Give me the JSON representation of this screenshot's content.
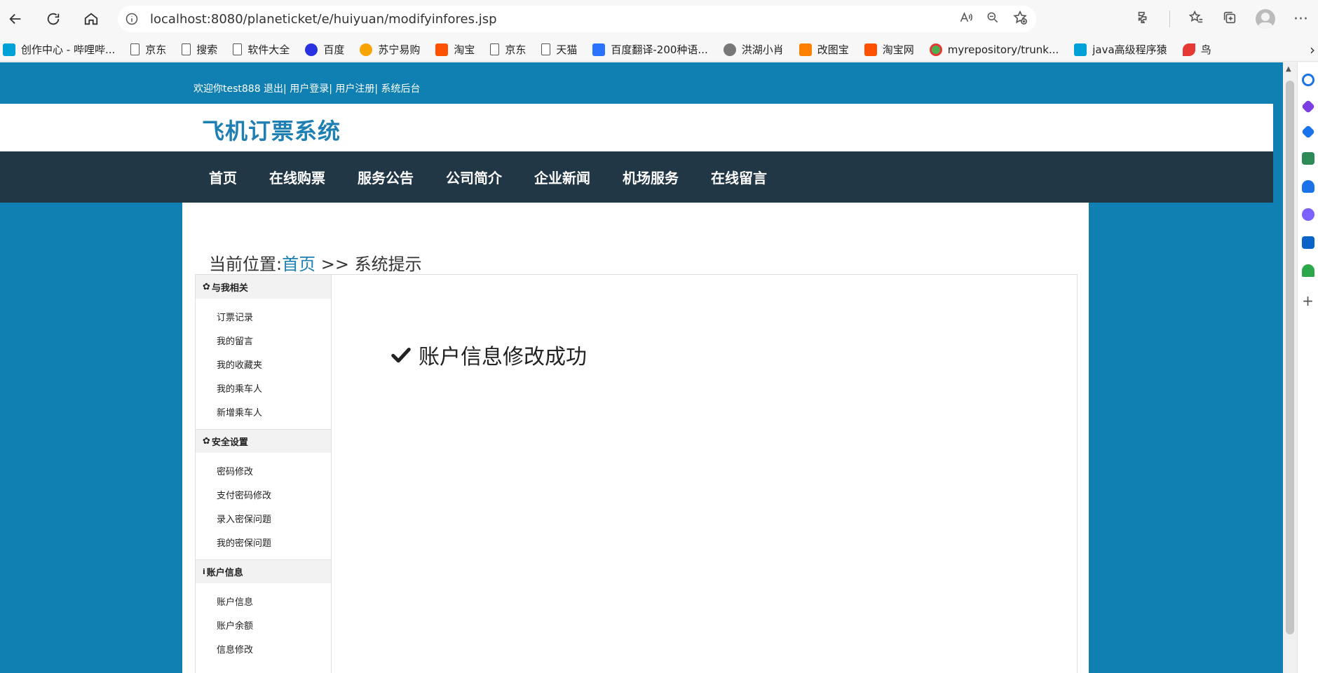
{
  "browser": {
    "url": "localhost:8080/planeticket/e/huiyuan/modifyinfores.jsp"
  },
  "bookmarks": [
    {
      "label": "创作中心 - 哔哩哔...",
      "icon": "bilibili-icon"
    },
    {
      "label": "京东",
      "icon": "page-icon"
    },
    {
      "label": "搜索",
      "icon": "page-icon"
    },
    {
      "label": "软件大全",
      "icon": "page-icon"
    },
    {
      "label": "百度",
      "icon": "baidu-icon"
    },
    {
      "label": "苏宁易购",
      "icon": "suning-icon"
    },
    {
      "label": "淘宝",
      "icon": "taobao-icon"
    },
    {
      "label": "京东",
      "icon": "page-icon"
    },
    {
      "label": "天猫",
      "icon": "page-icon"
    },
    {
      "label": "百度翻译-200种语...",
      "icon": "translate-icon"
    },
    {
      "label": "洪湖小肖",
      "icon": "hong-icon"
    },
    {
      "label": "改图宝",
      "icon": "gaitu-icon"
    },
    {
      "label": "淘宝网",
      "icon": "taobao-icon"
    },
    {
      "label": "myrepository/trunk...",
      "icon": "chrome-icon"
    },
    {
      "label": "java高级程序猿",
      "icon": "bilibili-icon"
    },
    {
      "label": "鸟",
      "icon": "bird-icon"
    }
  ],
  "site": {
    "topline": "欢迎你test888 退出| 用户登录| 用户注册| 系统后台",
    "title": "飞机订票系统",
    "nav": [
      "首页",
      "在线购票",
      "服务公告",
      "公司简介",
      "企业新闻",
      "机场服务",
      "在线留言"
    ],
    "breadcrumb": {
      "prefix": "当前位置:",
      "home": "首页",
      "suffix": " >> 系统提示"
    },
    "sidebar": [
      {
        "heading": "与我相关",
        "icon": "gear-icon",
        "items": [
          "订票记录",
          "我的留言",
          "我的收藏夹",
          "我的乘车人",
          "新增乘车人"
        ]
      },
      {
        "heading": "安全设置",
        "icon": "gear-icon",
        "items": [
          "密码修改",
          "支付密码修改",
          "录入密保问题",
          "我的密保问题"
        ]
      },
      {
        "heading": "账户信息",
        "icon": "info-icon",
        "items": [
          "账户信息",
          "账户余额",
          "信息修改"
        ]
      }
    ],
    "message": "账户信息修改成功"
  },
  "colors": {
    "page_bg": "#1080b3",
    "nav_bg": "#213745",
    "brand": "#1e7fb3"
  }
}
